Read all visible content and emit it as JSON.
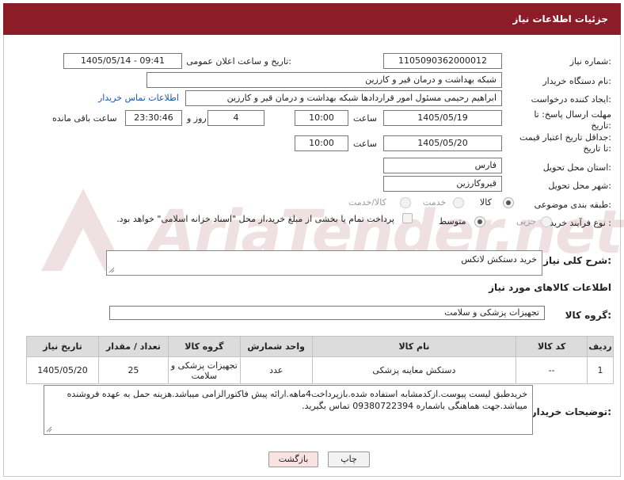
{
  "header": {
    "title": "جزئیات اطلاعات نیاز"
  },
  "fields": {
    "need_number": {
      "label": "شماره نیاز:",
      "value": "1105090362000012"
    },
    "announce": {
      "label": "تاریخ و ساعت اعلان عمومی:",
      "value": "1405/05/14 - 09:41"
    },
    "buyer_org": {
      "label": "نام دستگاه خریدار:",
      "value": "شبکه بهداشت و درمان قیر و کارزین"
    },
    "requester": {
      "label": "ایجاد کننده درخواست:",
      "value": "ابراهیم رحیمی مسئول امور قراردادها شبکه بهداشت و درمان قیر و کارزین",
      "contact_link": "اطلاعات تماس خریدار"
    },
    "reply_deadline": {
      "label_line1": "مهلت ارسال پاسخ: تا",
      "label_line2": "تاریخ:",
      "date": "1405/05/19",
      "time_label": "ساعت",
      "time": "10:00",
      "days": "4",
      "days_label": "روز و",
      "remaining": "23:30:46",
      "remaining_label": "ساعت باقی مانده"
    },
    "price_validity": {
      "label_line1": "جداقل تاریخ اعتبار قیمت:",
      "label_line2": "تا تاریخ:",
      "date": "1405/05/20",
      "time_label": "ساعت",
      "time": "10:00"
    },
    "province": {
      "label": "استان محل تحویل:",
      "value": "فارس"
    },
    "city": {
      "label": "شهر محل تحویل:",
      "value": "قیروکارزین"
    },
    "category": {
      "label": "طبقه بندی موضوعی:",
      "options": [
        "کالا",
        "خدمت",
        "کالا/خدمت"
      ],
      "selected": "کالا"
    },
    "process": {
      "label": "نوع فرآیند خرید :",
      "options": [
        "جزیی",
        "متوسط"
      ],
      "selected": "متوسط",
      "payment_note": "پرداخت تمام یا بخشی از مبلغ خرید،از محل \"اسناد خزانه اسلامی\" خواهد بود."
    }
  },
  "need_desc": {
    "label": "شرح کلی نیاز:",
    "value": "خرید دستکش لاتکس"
  },
  "goods_info": {
    "title": "اطلاعات کالاهای مورد نیاز"
  },
  "goods_group": {
    "label": "گروه کالا:",
    "value": "تجهیزات پزشکی و سلامت"
  },
  "table": {
    "headers": [
      "ردیف",
      "کد کالا",
      "نام کالا",
      "واحد شمارش",
      "گروه کالا",
      "تعداد / مقدار",
      "تاریخ نیاز"
    ],
    "rows": [
      [
        "1",
        "--",
        "دستکش معاینه پزشکی",
        "عدد",
        "تجهیزات پزشکی و سلامت",
        "25",
        "1405/05/20"
      ]
    ]
  },
  "buyer_notes": {
    "label": "توضیحات خریدار:",
    "value": "خریدطبق لیست پیوست.ازکدمشابه استفاده شده.بازپرداخت4ماهه.ارائه پیش فاکتورالزامی میباشد.هزینه حمل به عهده فروشنده میباشد.جهت هماهنگی باشماره 09380722394 تماس بگیرید."
  },
  "buttons": {
    "print": "چاپ",
    "back": "بازگشت"
  },
  "watermark": {
    "text": "AriaTender.net"
  },
  "colors": {
    "header_bg": "#8b1c28",
    "link": "#1a58a8",
    "back_button_bg": "#fbe2e2"
  }
}
